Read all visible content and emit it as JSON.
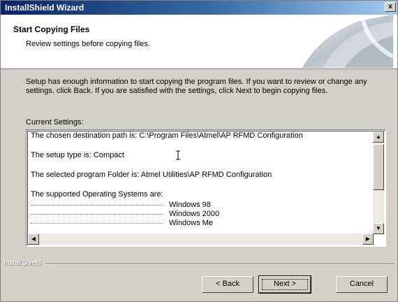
{
  "window": {
    "title": "InstallShield Wizard",
    "close_glyph": "x"
  },
  "header": {
    "title": "Start Copying Files",
    "subtitle": "Review settings before copying files."
  },
  "body": {
    "intro": "Setup has enough information to start copying the program files.  If you want to review or change any settings, click Back.  If you are satisfied with the settings, click Next to begin copying files.",
    "current_settings_label": "Current Settings:"
  },
  "settings": {
    "destination": "The chosen destination path is: C:\\Program Files\\Atmel\\AP RFMD Configuration",
    "setup_type": "The setup type is: Compact",
    "program_folder": "The selected program Folder is: Atmel Utilities\\AP RFMD Configuration",
    "os_label": "The supported Operating Systems are:",
    "os_list": [
      "Windows 98",
      "Windows 2000",
      "Windows Me"
    ]
  },
  "footer": {
    "brand": "InstallShield"
  },
  "buttons": {
    "back": "< Back",
    "next": "Next >",
    "cancel": "Cancel"
  }
}
